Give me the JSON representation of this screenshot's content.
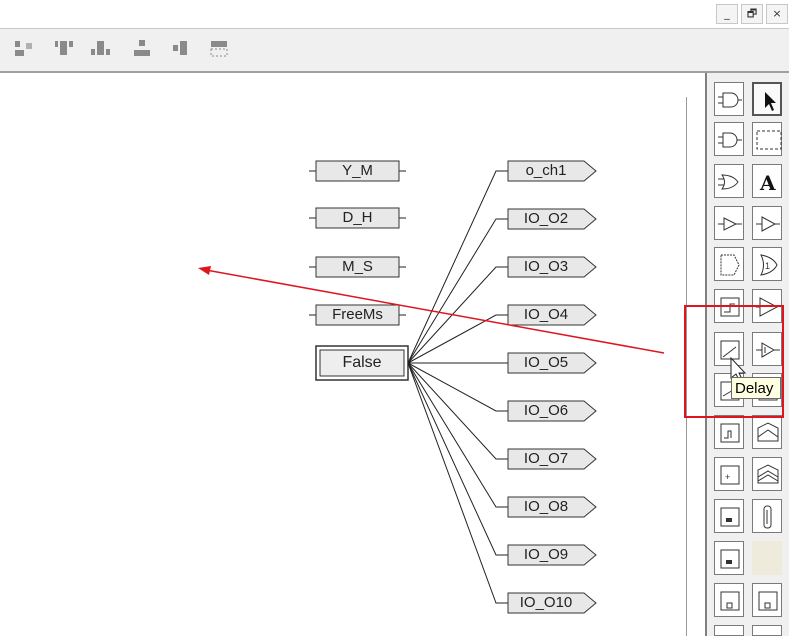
{
  "window": {
    "minimize": "_",
    "restore": "🗗",
    "close": "×"
  },
  "toolbar": {
    "buttons": [
      "align-left-icon",
      "align-top-icon",
      "align-bottom-icon",
      "align-center-icon",
      "align-right-icon",
      "distribute-icon"
    ]
  },
  "diagram": {
    "inputs": [
      "Y_M",
      "D_H",
      "M_S",
      "FreeMs"
    ],
    "constant": "False",
    "outputs": [
      "o_ch1",
      "IO_O2",
      "IO_O3",
      "IO_O4",
      "IO_O5",
      "IO_O6",
      "IO_O7",
      "IO_O8",
      "IO_O9",
      "IO_O10"
    ]
  },
  "palette": {
    "tooltip": "Delay",
    "tools": [
      "and-gate-icon",
      "pointer-icon",
      "nand-gate-icon",
      "select-rect-icon",
      "or-gate-icon",
      "text-icon",
      "buffer-icon",
      "buffer-alt-icon",
      "block-icon",
      "xor-icon",
      "timer-icon",
      "amplifier-icon",
      "delay-icon",
      "amplifier-alt-icon",
      "ramp-icon",
      "block2-icon",
      "pulse-icon",
      "wave-icon",
      "counter-icon",
      "wave2-icon",
      "latch-icon",
      "link-icon",
      "latch2-icon",
      "empty",
      "square-icon",
      "square2-icon"
    ]
  },
  "colors": {
    "annotation": "#e0141e",
    "io_fill": "#e8e8e8"
  }
}
